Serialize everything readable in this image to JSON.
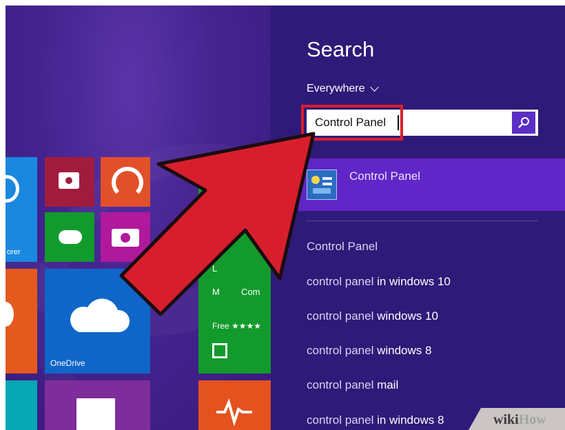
{
  "search_panel": {
    "title": "Search",
    "scope_label": "Everywhere",
    "query": "Control Panel",
    "top_result": {
      "label": "Control Panel",
      "icon": "control-panel-icon"
    },
    "suggestions": [
      {
        "normal": "Control Panel",
        "bold": ""
      },
      {
        "normal": "control panel",
        "bold": " in windows 10"
      },
      {
        "normal": "control panel",
        "bold": " windows 10"
      },
      {
        "normal": "control panel",
        "bold": " windows 8"
      },
      {
        "normal": "control panel",
        "bold": " mail"
      },
      {
        "normal": "control panel",
        "bold": " in windows 8"
      }
    ]
  },
  "start_screen": {
    "tiles": {
      "explorer_partial_label": "orer",
      "onedrive_label": "OneDrive",
      "store_partial_line1": "L",
      "store_partial_line2": "M",
      "store_partial_line3": "Com",
      "store_free_label": "Free ★★★★"
    }
  },
  "watermark": {
    "text_wiki": "wiki",
    "text_how": "How"
  },
  "colors": {
    "panel_bg": "#2e1a78",
    "result_highlight": "#6126c7",
    "search_button": "#5b2fc4",
    "annotation_red": "#d81e2c"
  }
}
